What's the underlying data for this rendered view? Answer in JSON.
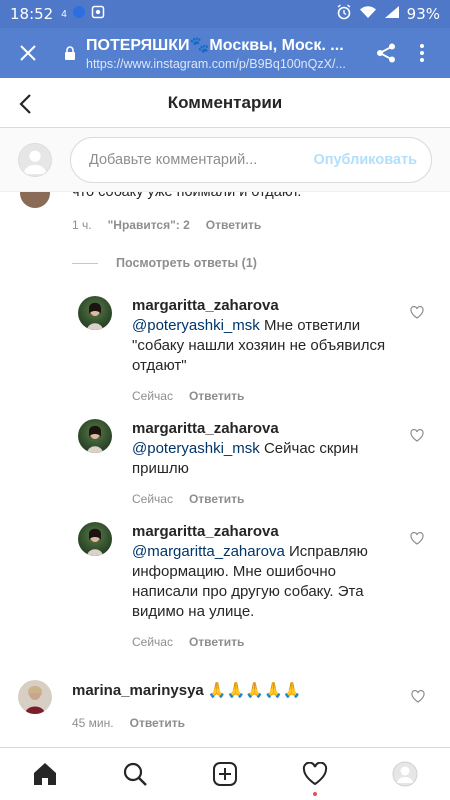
{
  "status_bar": {
    "time": "18:52",
    "network": "4",
    "battery": "93%"
  },
  "browser": {
    "page_title": "ПОТЕРЯШКИ🐾Москвы, Моск. ...",
    "url": "https://www.instagram.com/p/B9Bq100nQzX/..."
  },
  "header": {
    "title": "Комментарии"
  },
  "composer": {
    "placeholder": "Добавьте комментарий...",
    "publish_label": "Опубликовать"
  },
  "thread": {
    "partial_text": "что собаку уже поймали и отдают.",
    "time": "1 ч.",
    "likes": "\"Нравится\": 2",
    "reply_label": "Ответить",
    "view_replies": "Посмотреть ответы (1)"
  },
  "replies": [
    {
      "username": "margaritta_zaharova",
      "mention": "@poteryashki_msk",
      "text": " Мне ответили \"собаку нашли хозяин не объявился отдают\"",
      "time": "Сейчас",
      "reply_label": "Ответить"
    },
    {
      "username": "margaritta_zaharova",
      "mention": "@poteryashki_msk",
      "text": " Сейчас скрин пришлю",
      "time": "Сейчас",
      "reply_label": "Ответить"
    },
    {
      "username": "margaritta_zaharova",
      "mention": "@margaritta_zaharova",
      "text": " Исправляю информацию. Мне ошибочно написали про другую собаку. Эта видимо на улице.",
      "time": "Сейчас",
      "reply_label": "Ответить"
    }
  ],
  "comment2": {
    "username": "marina_marinysya",
    "text": " 🙏🙏🙏🙏🙏",
    "time": "45 мин.",
    "reply_label": "Ответить"
  },
  "bottom_nav": [
    "home-icon",
    "search-icon",
    "new-post-icon",
    "activity-icon",
    "profile-icon"
  ],
  "colors": {
    "status_bar": "#4f78c9",
    "browser_bar": "#5580d0",
    "mention": "#003569",
    "publish_disabled": "#b2dffc",
    "notification_dot": "#ed4956"
  }
}
